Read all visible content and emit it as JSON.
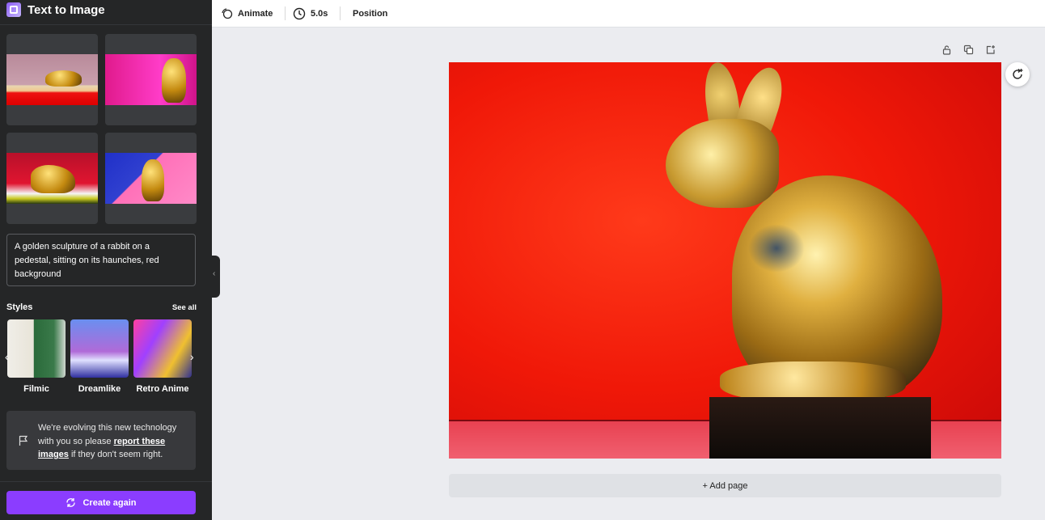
{
  "sidebar": {
    "app_title": "Text to Image",
    "prompt_text": "A golden sculpture of a rabbit on a pedestal, sitting on its haunches, red background",
    "styles_title": "Styles",
    "see_all": "See all",
    "styles": [
      {
        "label": "Filmic"
      },
      {
        "label": "Dreamlike"
      },
      {
        "label": "Retro Anime"
      }
    ],
    "note": {
      "text_before": "We're evolving this new technology with you so please ",
      "link": "report these images",
      "text_after": " if they don't seem right."
    },
    "create_button": "Create again"
  },
  "toolbar": {
    "animate": "Animate",
    "duration": "5.0s",
    "position": "Position"
  },
  "canvas": {
    "add_page": "+ Add page"
  },
  "colors": {
    "accent": "#8b3dff",
    "sidebar_bg": "#252627",
    "canvas_bg": "#ebecf0"
  }
}
